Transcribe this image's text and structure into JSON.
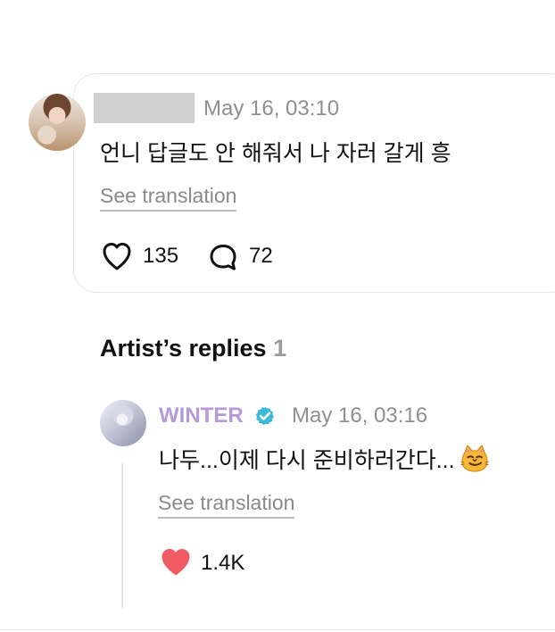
{
  "post": {
    "masked_username": "",
    "timestamp": "May 16, 03:10",
    "text": "언니 답글도 안 해줘서 나 자러 갈게 흥",
    "see_translation": "See translation",
    "likes": "135",
    "comments": "72"
  },
  "replies_section": {
    "title": "Artist’s replies",
    "count": "1"
  },
  "reply": {
    "artist_name": "WINTER",
    "verified_icon": "verified-badge-icon",
    "timestamp": "May 16, 03:16",
    "text": "나두...이제 다시 준비하러간다...",
    "emoji": "smirking-cat-emoji",
    "see_translation": "See translation",
    "likes": "1.4K"
  },
  "colors": {
    "artist_name": "#b69ad8",
    "verified": "#3bb9d8",
    "liked_heart": "#f05a63",
    "muted_text": "#8f8f8f"
  }
}
